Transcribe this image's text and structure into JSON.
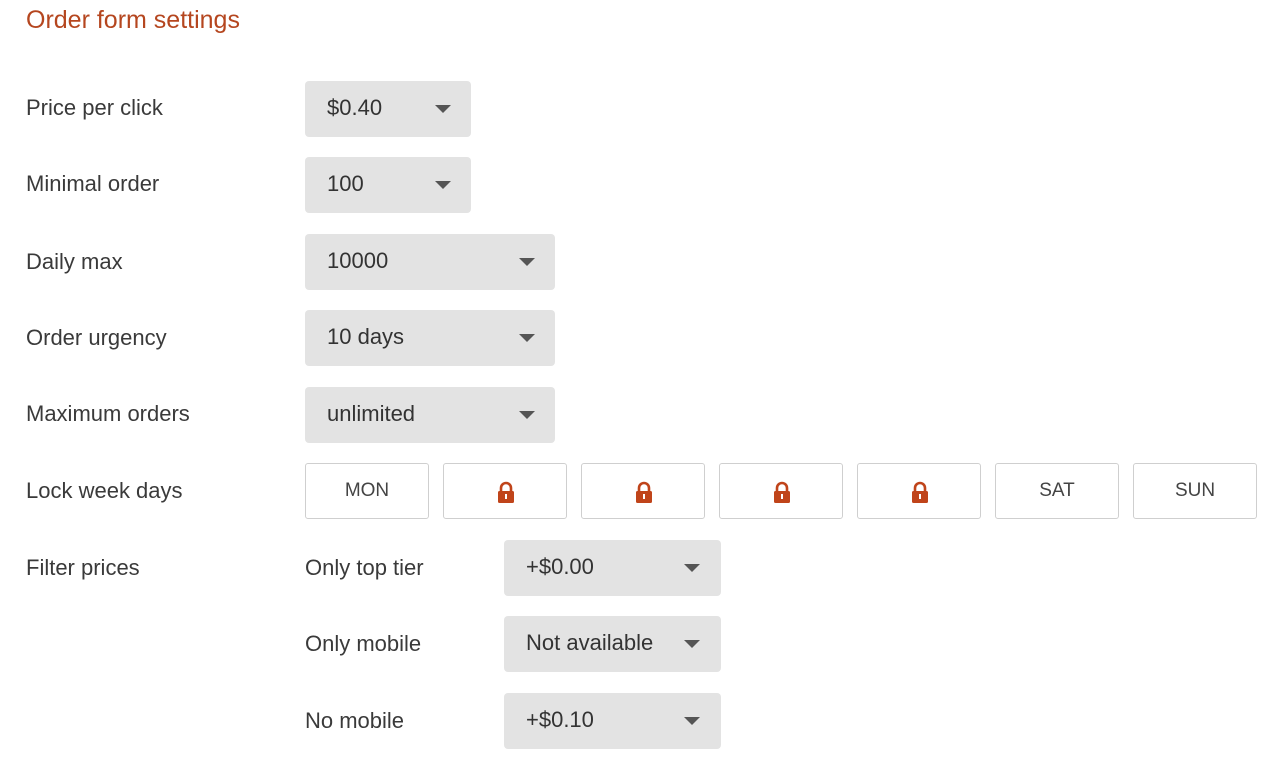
{
  "header": {
    "title": "Order form settings"
  },
  "settings": {
    "price_per_click": {
      "label": "Price per click",
      "value": "$0.40"
    },
    "minimal_order": {
      "label": "Minimal order",
      "value": "100"
    },
    "daily_max": {
      "label": "Daily max",
      "value": "10000"
    },
    "order_urgency": {
      "label": "Order urgency",
      "value": "10 days"
    },
    "maximum_orders": {
      "label": "Maximum orders",
      "value": "unlimited"
    }
  },
  "lock_week_days": {
    "label": "Lock week days",
    "days": [
      {
        "text": "MON",
        "locked": false
      },
      {
        "text": "",
        "locked": true,
        "icon": "lock-icon"
      },
      {
        "text": "",
        "locked": true,
        "icon": "lock-icon"
      },
      {
        "text": "",
        "locked": true,
        "icon": "lock-icon"
      },
      {
        "text": "",
        "locked": true,
        "icon": "lock-icon"
      },
      {
        "text": "SAT",
        "locked": false
      },
      {
        "text": "SUN",
        "locked": false
      }
    ]
  },
  "filter_prices": {
    "label": "Filter prices",
    "options": [
      {
        "label": "Only top tier",
        "value": "+$0.00"
      },
      {
        "label": "Only mobile",
        "value": "Not available"
      },
      {
        "label": "No mobile",
        "value": "+$0.10"
      }
    ]
  },
  "colors": {
    "accent": "#b5461f",
    "select_bg": "#e3e3e3",
    "lock": "#c0441a"
  }
}
